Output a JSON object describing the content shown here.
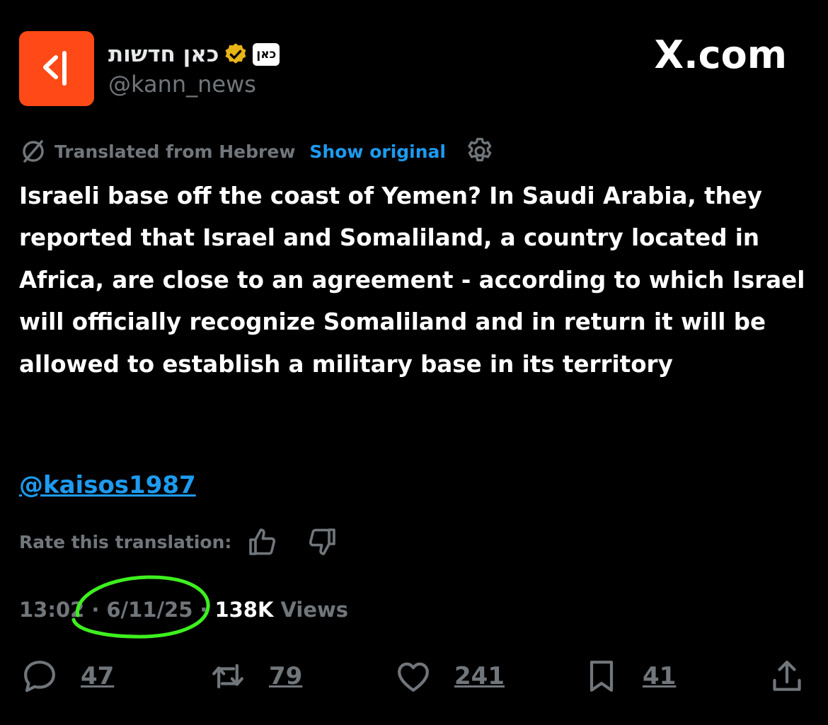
{
  "author": {
    "display_name": "כאן חדשות",
    "affiliate_badge": "כאן",
    "handle": "@kann_news",
    "avatar_color": "#ff4a17",
    "verified_color": "#e6b416"
  },
  "site_name": "X.com",
  "translation": {
    "label": "Translated from Hebrew",
    "show_original": "Show original"
  },
  "tweet": {
    "text": "Israeli base off the coast of Yemen? In Saudi Arabia, they reported that Israel and Somaliland, a country located in Africa, are close to an agreement - according to which Israel will officially recognize Somaliland and in return it will be allowed to establish a military base in its territory",
    "mention": "@kaisos1987"
  },
  "rate": {
    "label": "Rate this translation:"
  },
  "meta": {
    "time": "13:02",
    "date": "6/11/25",
    "separator": "·",
    "views_count": "138K",
    "views_label": "Views"
  },
  "actions": {
    "replies": "47",
    "reposts": "79",
    "likes": "241",
    "bookmarks": "41"
  },
  "colors": {
    "background": "#000000",
    "text": "#ffffff",
    "muted": "#71767b",
    "link": "#1d9bf0",
    "annotation": "#3ef01f"
  }
}
